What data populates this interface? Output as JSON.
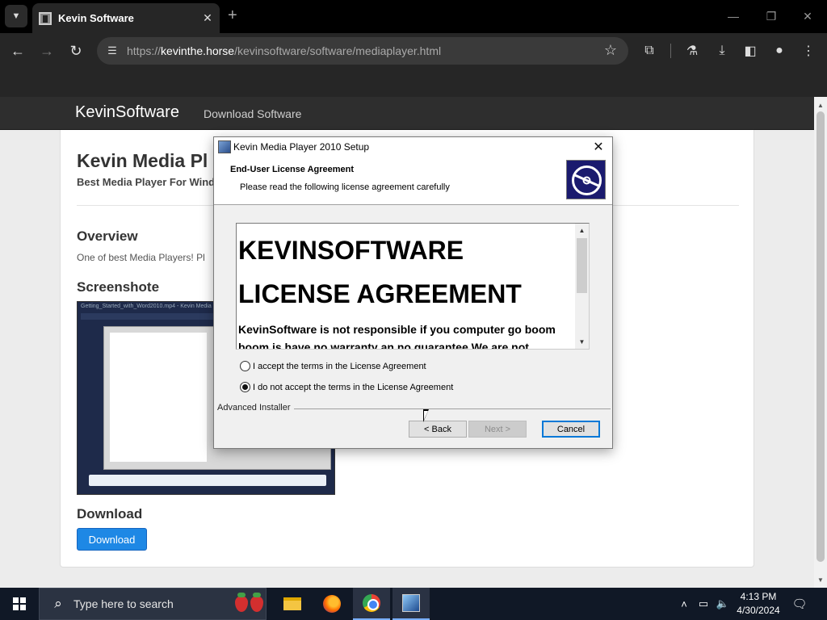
{
  "browser": {
    "tab_title": "Kevin Software",
    "tab_close": "✕",
    "new_tab": "+",
    "url_prefix": "https://",
    "url_host": "kevinthe.horse",
    "url_path": "/kevinsoftware/software/mediaplayer.html"
  },
  "site": {
    "brand": "KevinSoftware",
    "nav_link": "Download Software",
    "title": "Kevin Media Pl",
    "subtitle": "Best Media Player For Wind",
    "overview_heading": "Overview",
    "overview_text": "One of best Media Players! Pl",
    "screenshot_heading": "Screenshote",
    "screenshot_caption": "Getting_Started_with_Word2010.mp4 - Kevin Media",
    "download_heading": "Download",
    "download_button": "Download"
  },
  "dialog": {
    "title": "Kevin Media Player 2010 Setup",
    "header_title": "End-User License Agreement",
    "header_subtitle": "Please read the following license agreement carefully",
    "license_heading_1": "KEVINSOFTWARE",
    "license_heading_2": "LICENSE AGREEMENT",
    "license_body": "KevinSoftware is not responsible if you computer go boom boom is have no warranty an no guarantee We are not",
    "accept_label": "I accept the terms in the License Agreement",
    "decline_label": "I do not accept the terms in the License Agreement",
    "selected_option": "decline",
    "footer_label": "Advanced Installer",
    "back_button": "< Back",
    "next_button": "Next >",
    "cancel_button": "Cancel"
  },
  "taskbar": {
    "search_placeholder": "Type here to search",
    "time": "4:13 PM",
    "date": "4/30/2024"
  },
  "colors": {
    "accent_blue": "#1e88e5",
    "site_nav": "#2e2e2e",
    "browser_dark": "#262626",
    "taskbar": "#101826"
  }
}
